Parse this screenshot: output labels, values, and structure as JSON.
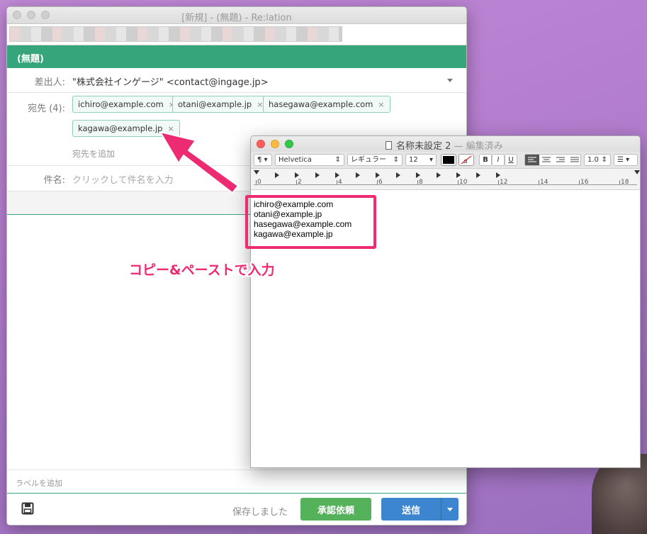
{
  "main_window": {
    "title": "[新規] - (無題) - Re:lation",
    "header": "(無題)",
    "from": {
      "label": "差出人:",
      "value": "\"株式会社インゲージ\" <contact@ingage.jp>"
    },
    "to": {
      "label": "宛先 (4):",
      "recipients": [
        "ichiro@example.com",
        "otani@example.jp",
        "hasegawa@example.com",
        "kagawa@example.jp"
      ],
      "remove_glyph": "×",
      "add_placeholder": "宛先を追加"
    },
    "subject": {
      "label": "件名:",
      "placeholder": "クリックして件名を入力"
    },
    "label_add": "ラベルを追加",
    "footer": {
      "save_icon": "floppy-disk-icon",
      "saved_status": "保存しました",
      "approve_button": "承認依頼",
      "send_button": "送信"
    },
    "accent_color": "#37a57c"
  },
  "textedit_window": {
    "title": "名称未設定 2",
    "edited": "— 編集済み",
    "toolbar": {
      "paragraph": "¶",
      "font_family": "Helvetica",
      "font_style": "レギュラー",
      "font_size": "12",
      "bold": "B",
      "italic": "I",
      "underline": "U",
      "line_spacing": "1.0"
    },
    "ruler_labels": [
      "0",
      "2",
      "4",
      "6",
      "8",
      "10",
      "12",
      "14",
      "16",
      "18"
    ],
    "lines": [
      "ichiro@example.com",
      "otani@example.jp",
      "hasegawa@example.com",
      "kagawa@example.jp"
    ]
  },
  "annotation": {
    "text": "コピー&ペーストで入力",
    "color": "#ec2b72"
  }
}
